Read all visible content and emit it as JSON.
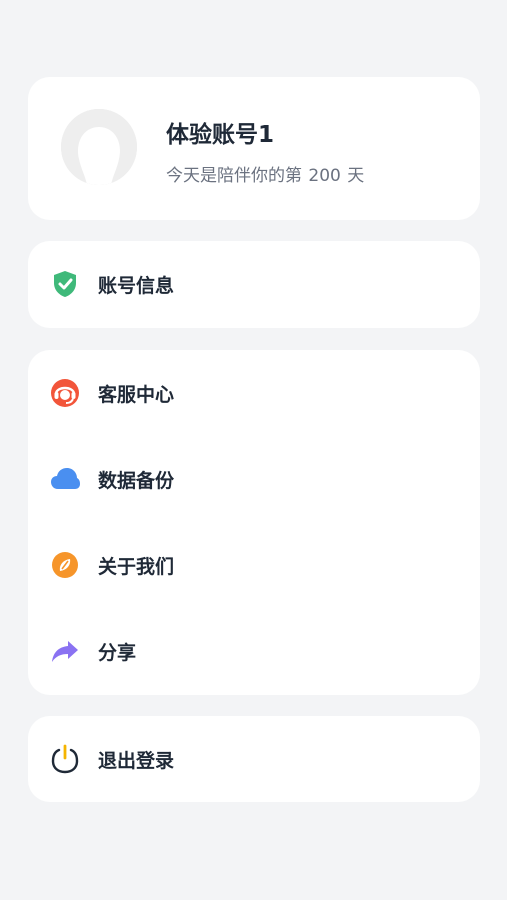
{
  "status_bar": {
    "time": "",
    "indicators": ""
  },
  "profile": {
    "name": "体验账号1",
    "subtitle_prefix": "今天是陪伴你的第",
    "days": "200",
    "subtitle_suffix": "天"
  },
  "account": {
    "label": "账号信息",
    "icon": "shield-check-icon",
    "icon_color": "#3fb97a"
  },
  "menu": {
    "items": [
      {
        "label": "客服中心",
        "icon": "customer-service-icon",
        "icon_color": "#f2553a"
      },
      {
        "label": "数据备份",
        "icon": "cloud-icon",
        "icon_color": "#4a8ff0"
      },
      {
        "label": "关于我们",
        "icon": "compass-icon",
        "icon_color": "#f6952a"
      },
      {
        "label": "分享",
        "icon": "share-arrow-icon",
        "icon_color": "#8a72f2"
      }
    ]
  },
  "logout": {
    "label": "退出登录",
    "icon": "power-icon",
    "icon_color": "#1f2937",
    "accent": "#f5b400"
  },
  "colors": {
    "background": "#f3f4f6",
    "card": "#ffffff",
    "text_primary": "#1f2937",
    "text_secondary": "#6b7280"
  }
}
